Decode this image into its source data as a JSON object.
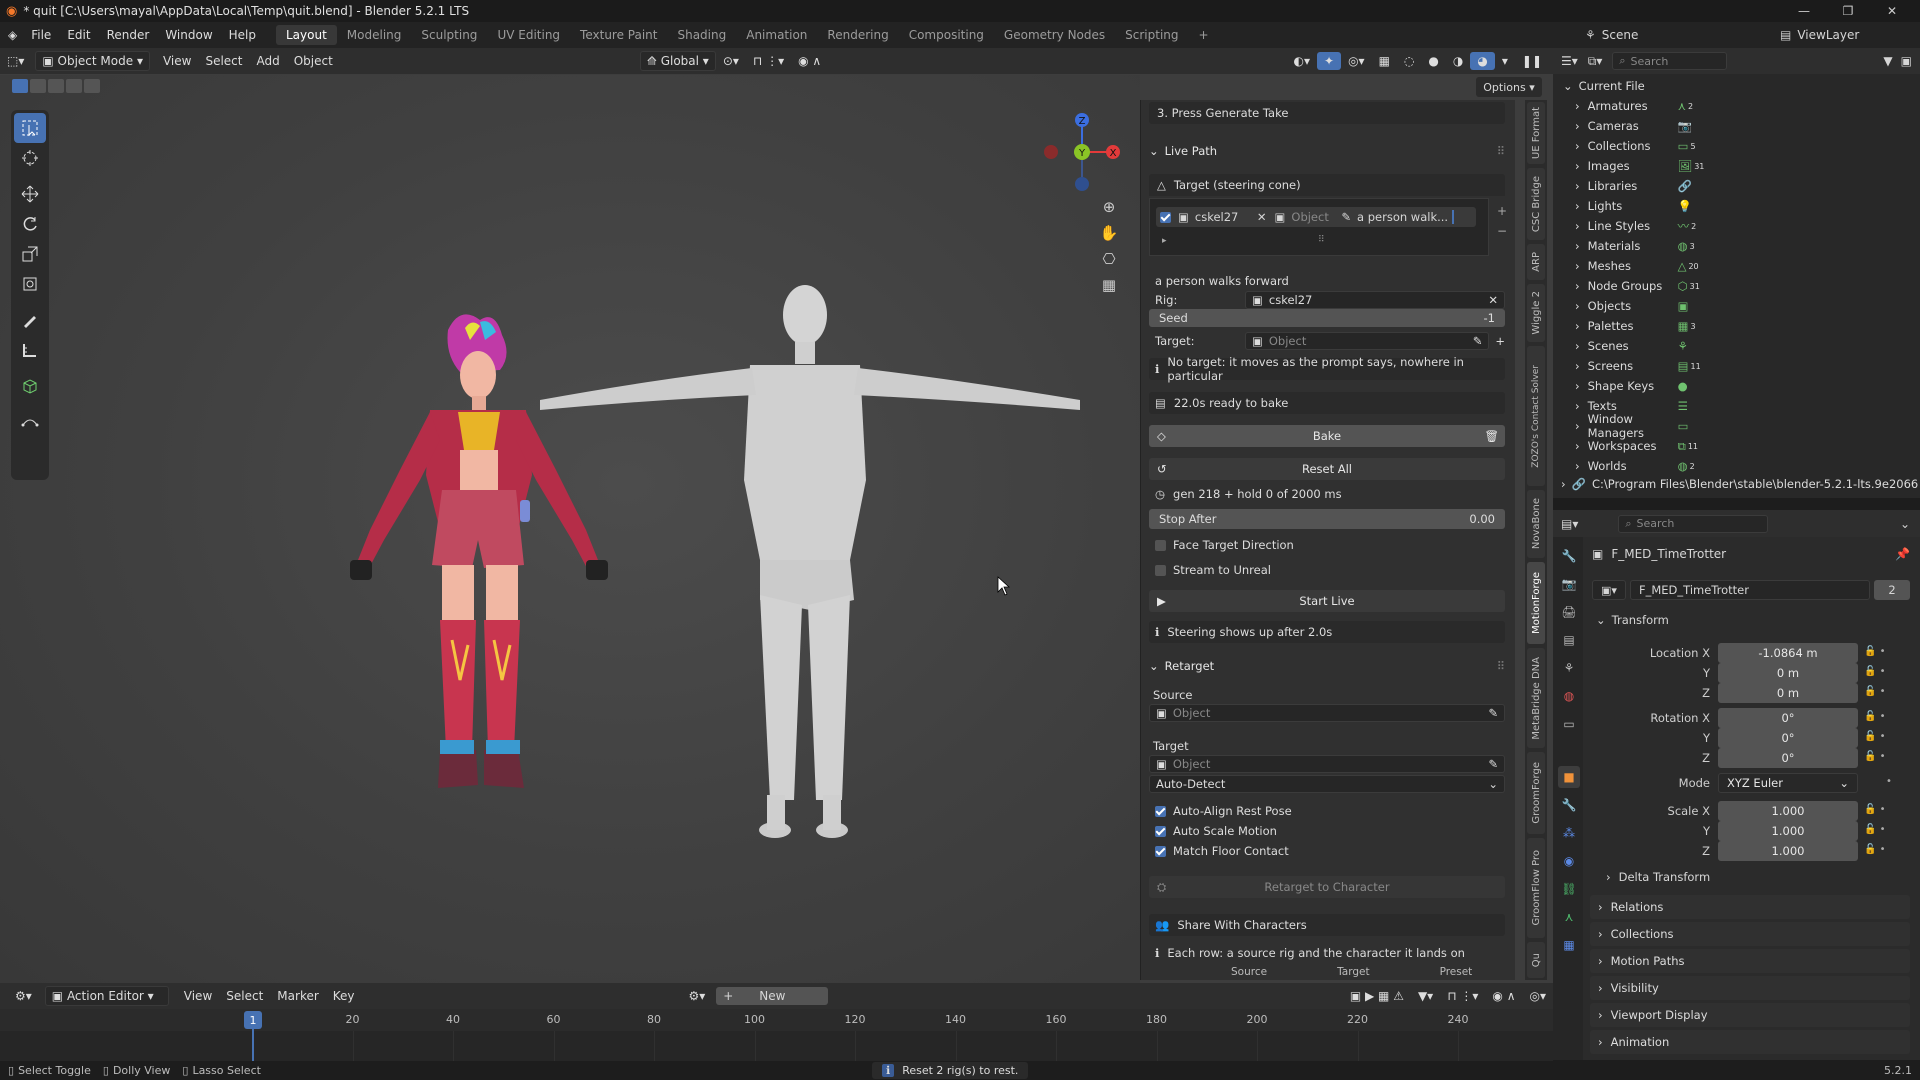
{
  "window": {
    "title": "* quit [C:\\Users\\mayal\\AppData\\Local\\Temp\\quit.blend] - Blender 5.2.1 LTS"
  },
  "menu": [
    "File",
    "Edit",
    "Render",
    "Window",
    "Help"
  ],
  "workspaces": [
    "Layout",
    "Modeling",
    "Sculpting",
    "UV Editing",
    "Texture Paint",
    "Shading",
    "Animation",
    "Rendering",
    "Compositing",
    "Geometry Nodes",
    "Scripting"
  ],
  "scene": {
    "name": "Scene",
    "view_layer": "ViewLayer"
  },
  "viewport_header": {
    "mode": "Object Mode",
    "menus": [
      "View",
      "Select",
      "Add",
      "Object"
    ],
    "transform": "Global",
    "options": "Options"
  },
  "gizmo": {
    "x": "X",
    "y": "Y",
    "z": "Z"
  },
  "npanel": {
    "step3": "3.  Press Generate Take",
    "live_path": {
      "title": "Live Path",
      "target_header": "Target (steering cone)",
      "row": {
        "rig": "cskel27",
        "object_placeholder": "Object",
        "prompt_short": "a person walk..."
      },
      "prompt": "a person walks forward",
      "rig_label": "Rig:",
      "rig_value": "cskel27",
      "seed_label": "Seed",
      "seed_value": "-1",
      "target_label": "Target:",
      "target_placeholder": "Object",
      "no_target_note": "No target: it moves as the prompt says, nowhere in particular",
      "ready": "22.0s ready to bake",
      "bake": "Bake",
      "reset_all": "Reset All",
      "gen_status": "gen 218 + hold 0 of 2000 ms",
      "stop_after_label": "Stop After",
      "stop_after_value": "0.00",
      "face_target": "Face Target Direction",
      "stream": "Stream to Unreal",
      "start_live": "Start Live",
      "steering_note": "Steering shows up after 2.0s"
    },
    "retarget": {
      "title": "Retarget",
      "source_label": "Source",
      "source_placeholder": "Object",
      "target_label": "Target",
      "target_placeholder": "Object",
      "mode": "Auto-Detect",
      "auto_align": "Auto-Align Rest Pose",
      "auto_scale": "Auto Scale Motion",
      "match_floor": "Match Floor Contact",
      "retarget_btn": "Retarget to Character",
      "share": "Share With Characters",
      "share_note": "Each row: a source rig and the character it lands on",
      "cols": [
        "Source",
        "Target",
        "Preset"
      ]
    }
  },
  "side_tabs": [
    "UE Format",
    "CSC Bridge",
    "ARP",
    "Wiggle 2",
    "ZOZO's Contact Solver",
    "NovaBone",
    "MotionForge",
    "MetaBridge DNA",
    "GroomForge",
    "GroomFlow Pro",
    "Qu"
  ],
  "outliner": {
    "search_placeholder": "Search",
    "root": "Current File",
    "items": [
      {
        "label": "Armatures",
        "badge": "2"
      },
      {
        "label": "Cameras",
        "badge": ""
      },
      {
        "label": "Collections",
        "badge": "5"
      },
      {
        "label": "Images",
        "badge": "31"
      },
      {
        "label": "Libraries",
        "badge": ""
      },
      {
        "label": "Lights",
        "badge": ""
      },
      {
        "label": "Line Styles",
        "badge": "2"
      },
      {
        "label": "Materials",
        "badge": "3"
      },
      {
        "label": "Meshes",
        "badge": "20"
      },
      {
        "label": "Node Groups",
        "badge": "31"
      },
      {
        "label": "Objects",
        "badge": ""
      },
      {
        "label": "Palettes",
        "badge": "3"
      },
      {
        "label": "Scenes",
        "badge": ""
      },
      {
        "label": "Screens",
        "badge": "11"
      },
      {
        "label": "Shape Keys",
        "badge": ""
      },
      {
        "label": "Texts",
        "badge": ""
      },
      {
        "label": "Window Managers",
        "badge": ""
      },
      {
        "label": "Workspaces",
        "badge": "11"
      },
      {
        "label": "Worlds",
        "badge": "2"
      }
    ],
    "path": "C:\\Program Files\\Blender\\stable\\blender-5.2.1-lts.9e2066a"
  },
  "properties": {
    "search_placeholder": "Search",
    "object_name": "F_MED_TimeTrotter",
    "data_name": "F_MED_TimeTrotter",
    "users": "2",
    "transform_title": "Transform",
    "location_label": "Location X",
    "loc": [
      "-1.0864 m",
      "0 m",
      "0 m"
    ],
    "rotation_label": "Rotation X",
    "rot": [
      "0°",
      "0°",
      "0°"
    ],
    "mode_label": "Mode",
    "mode_value": "XYZ Euler",
    "scale_label": "Scale X",
    "scale": [
      "1.000",
      "1.000",
      "1.000"
    ],
    "axis_y": "Y",
    "axis_z": "Z",
    "sections": [
      "Delta Transform",
      "Relations",
      "Collections",
      "Motion Paths",
      "Visibility",
      "Viewport Display",
      "Animation"
    ]
  },
  "timeline": {
    "editor": "Action Editor",
    "menus": [
      "View",
      "Select",
      "Marker",
      "Key"
    ],
    "new": "New",
    "current_frame": "1",
    "frame_labels": [
      "20",
      "40",
      "60",
      "80",
      "100",
      "120",
      "140",
      "160",
      "180",
      "200",
      "220",
      "240"
    ]
  },
  "status": {
    "hints": [
      "Select Toggle",
      "Dolly View",
      "Lasso Select"
    ],
    "message": "Reset 2 rig(s) to rest.",
    "version": "5.2.1"
  },
  "colors": {
    "accent": "#4772b3",
    "x_axis": "#e33a3a",
    "y_axis": "#8ac526",
    "z_axis": "#3b6ee0"
  }
}
